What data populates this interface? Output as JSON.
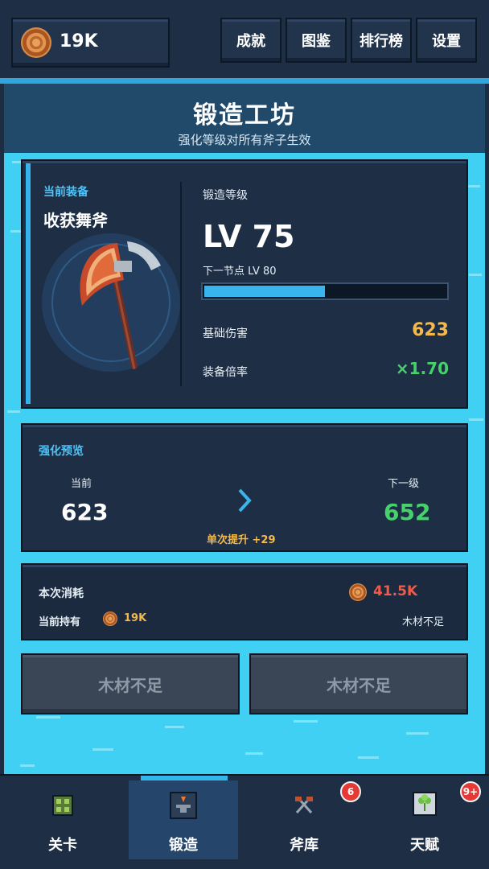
{
  "topbar": {
    "wood_amount": "19K",
    "buttons": [
      "成就",
      "图鉴",
      "排行榜",
      "设置"
    ]
  },
  "header": {
    "title": "锻造工坊",
    "subtitle": "强化等级对所有斧子生效"
  },
  "equipment": {
    "label": "当前装备",
    "name": "收获舞斧",
    "forge_label": "锻造等级",
    "level": "LV 75",
    "next_node": "下一节点  LV 80",
    "progress": 0.5,
    "base_damage_label": "基础伤害",
    "base_damage": "623",
    "multiplier_label": "装备倍率",
    "multiplier": "×1.70"
  },
  "preview": {
    "label": "强化预览",
    "current_label": "当前",
    "current_value": "623",
    "next_label": "下一级",
    "next_value": "652",
    "increase": "单次提升  +29"
  },
  "cost": {
    "label": "本次消耗",
    "amount": "41.5K",
    "holding_label": "当前持有",
    "holding": "19K",
    "status": "木材不足"
  },
  "actions": {
    "left": "木材不足",
    "right": "木材不足"
  },
  "nav": [
    {
      "label": "关卡",
      "icon": "stage-icon"
    },
    {
      "label": "锻造",
      "icon": "anvil-icon",
      "selected": true
    },
    {
      "label": "斧库",
      "icon": "axes-icon",
      "badge": "6"
    },
    {
      "label": "天赋",
      "icon": "talent-icon",
      "badge": "9+"
    }
  ],
  "colors": {
    "accent": "#33b5ee",
    "water": "#3fd0f4",
    "panel": "#1e2f45",
    "gold": "#f5b84a",
    "green": "#46d26a",
    "red": "#f05a4a"
  }
}
